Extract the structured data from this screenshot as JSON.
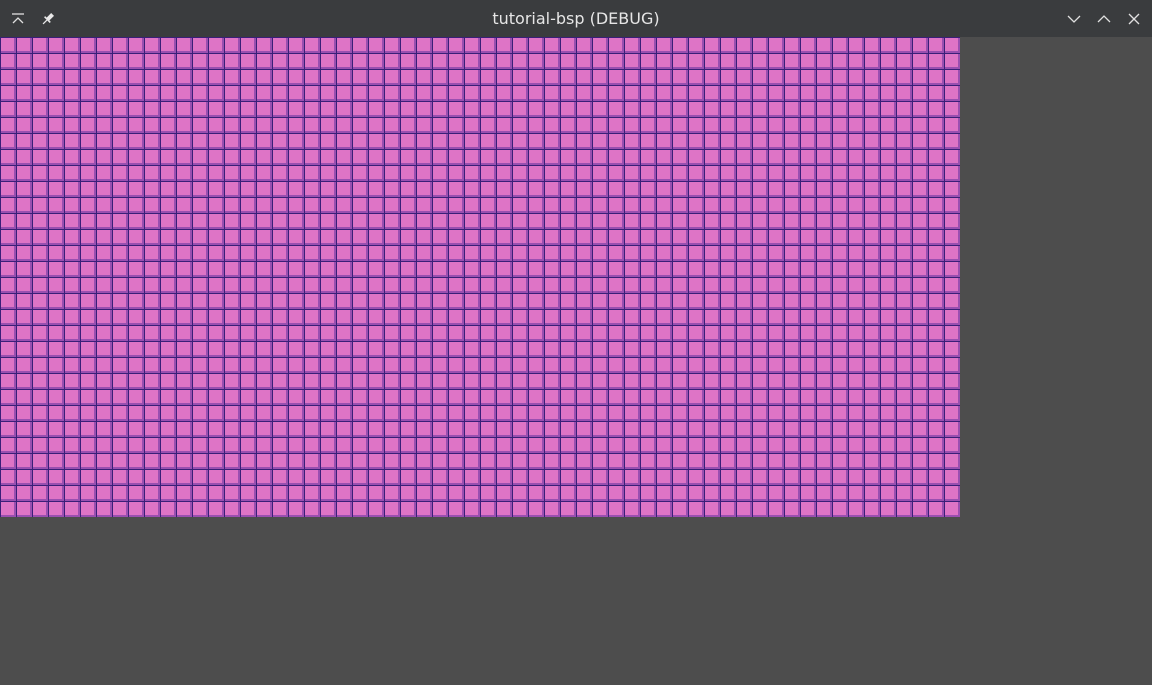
{
  "window": {
    "title": "tutorial-bsp (DEBUG)"
  },
  "titlebar": {
    "buttons": [
      {
        "name": "keep-above-icon"
      },
      {
        "name": "pin-icon"
      },
      {
        "name": "minimize-icon"
      },
      {
        "name": "maximize-icon"
      },
      {
        "name": "close-icon"
      }
    ]
  },
  "colors": {
    "titlebar_bg": "#3a3c3e",
    "viewport_bg": "#4d4d4d",
    "tile_fill": "#de74c6",
    "tile_border": "#3a1f78"
  },
  "viewport": {
    "tilemap": {
      "cols": 60,
      "rows": 30
    }
  }
}
